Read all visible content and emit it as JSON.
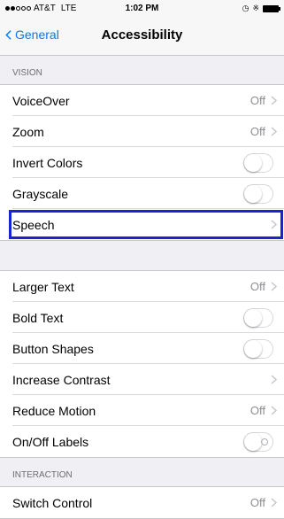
{
  "status": {
    "carrier": "AT&T",
    "network": "LTE",
    "time": "1:02 PM"
  },
  "nav": {
    "back_label": "General",
    "title": "Accessibility"
  },
  "sections": {
    "vision_header": "VISION",
    "interaction_header": "INTERACTION"
  },
  "vision": [
    {
      "label": "VoiceOver",
      "value": "Off"
    },
    {
      "label": "Zoom",
      "value": "Off"
    },
    {
      "label": "Invert Colors"
    },
    {
      "label": "Grayscale"
    },
    {
      "label": "Speech"
    }
  ],
  "text": [
    {
      "label": "Larger Text",
      "value": "Off"
    },
    {
      "label": "Bold Text"
    },
    {
      "label": "Button Shapes"
    },
    {
      "label": "Increase Contrast"
    },
    {
      "label": "Reduce Motion",
      "value": "Off"
    },
    {
      "label": "On/Off Labels"
    }
  ],
  "interaction": [
    {
      "label": "Switch Control",
      "value": "Off"
    }
  ],
  "colors": {
    "accent": "#007aff",
    "highlight": "#1a22d6",
    "background": "#efeff4"
  }
}
